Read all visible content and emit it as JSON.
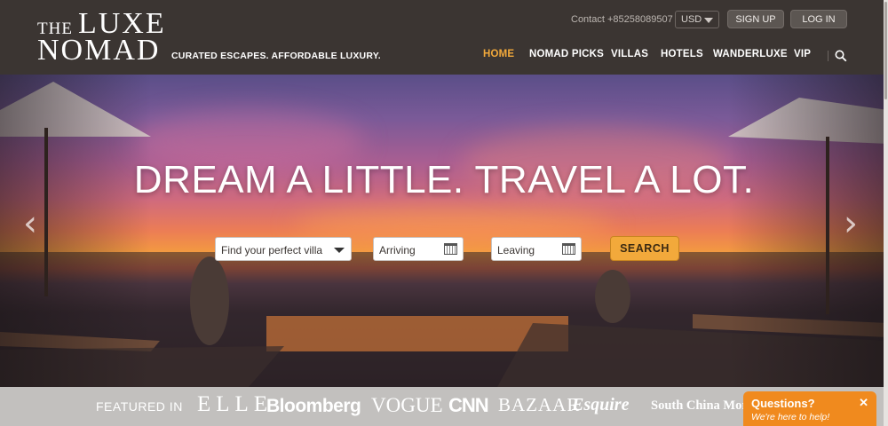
{
  "brand": {
    "logo_line1_small": "THE",
    "logo_line1_large": "LUXE",
    "logo_line2": "NOMAD",
    "tagline": "CURATED ESCAPES. AFFORDABLE LUXURY."
  },
  "header": {
    "contact": "Contact +85258089507",
    "currency": "USD",
    "signup_label": "SIGN UP",
    "login_label": "LOG IN"
  },
  "nav": {
    "items": [
      "HOME",
      "NOMAD PICKS",
      "VILLAS",
      "HOTELS",
      "WANDERLUXE",
      "VIP"
    ],
    "active": "HOME",
    "search_icon": "search-icon"
  },
  "hero": {
    "headline": "DREAM A LITTLE. TRAVEL A LOT.",
    "villa_select": "Find your perfect villa",
    "arriving_label": "Arriving",
    "leaving_label": "Leaving",
    "search_label": "SEARCH",
    "prev_icon": "chevron-left-icon",
    "next_icon": "chevron-right-icon"
  },
  "featured": {
    "label": "FEATURED IN",
    "publications": [
      "ELLE",
      "Bloomberg",
      "VOGUE",
      "CNN",
      "BAZAAR",
      "Esquire",
      "South China Morn"
    ]
  },
  "chat": {
    "title": "Questions?",
    "subtitle": "We're here to help!",
    "close_icon": "close-icon"
  },
  "colors": {
    "header_bg": "#3b3532",
    "accent": "#f2a93b",
    "chat_orange": "#f08a1e",
    "featured_bg": "#c2c0be"
  }
}
